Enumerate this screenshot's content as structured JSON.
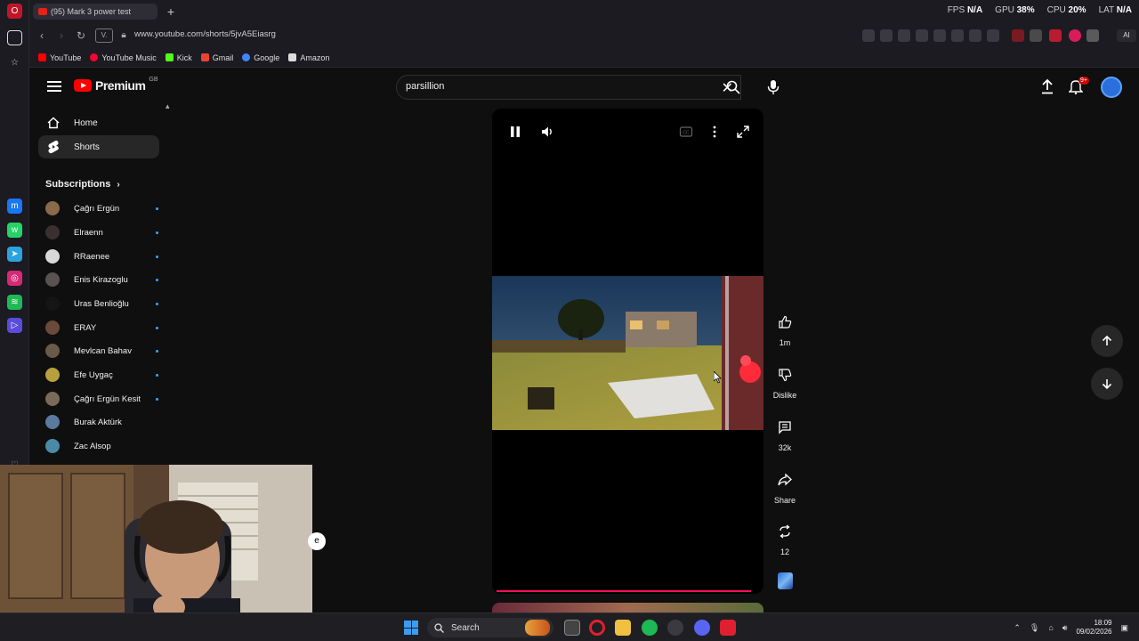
{
  "browser": {
    "tab_title": "(95) Mark 3 power test",
    "stats": [
      {
        "label": "FPS",
        "value": "N/A"
      },
      {
        "label": "GPU",
        "value": "38%"
      },
      {
        "label": "CPU",
        "value": "20%"
      },
      {
        "label": "LAT",
        "value": "N/A"
      }
    ],
    "url": "www.youtube.com/shorts/5jvA5Eiasrg",
    "bookmarks": [
      {
        "label": "YouTube",
        "color": "#ff0000"
      },
      {
        "label": "YouTube Music",
        "color": "#ff0033"
      },
      {
        "label": "Kick",
        "color": "#53fc18"
      },
      {
        "label": "Gmail",
        "color": "#ea4335"
      },
      {
        "label": "Google",
        "color": "#4285f4"
      },
      {
        "label": "Amazon",
        "color": "#dddddd"
      }
    ]
  },
  "header": {
    "logo_text": "Premium",
    "logo_super": "GB",
    "search_value": "parsillion",
    "notification_count": "9+"
  },
  "guide": {
    "items": [
      {
        "label": "Home",
        "icon": "home-icon"
      },
      {
        "label": "Shorts",
        "icon": "shorts-icon"
      }
    ],
    "subscriptions_title": "Subscriptions",
    "subscriptions": [
      {
        "name": "Çağrı Ergün",
        "color": "#8a6a4a",
        "new": true
      },
      {
        "name": "Elraenn",
        "color": "#3a3030",
        "new": true
      },
      {
        "name": "RRaenee",
        "color": "#d8d8d8",
        "new": true
      },
      {
        "name": "Enis Kirazoglu",
        "color": "#5a5250",
        "new": true
      },
      {
        "name": "Uras Benlioğlu",
        "color": "#151515",
        "new": true
      },
      {
        "name": "ERAY",
        "color": "#6a4a3a",
        "new": true
      },
      {
        "name": "Mevlcan Bahav",
        "color": "#6a5a4a",
        "new": true
      },
      {
        "name": "Efe Uygaç",
        "color": "#b8a040",
        "new": true
      },
      {
        "name": "Çağrı Ergün Kesit",
        "color": "#7a6a5a",
        "new": true
      },
      {
        "name": "Burak Aktürk",
        "color": "#5a7aa0",
        "new": false
      },
      {
        "name": "Zac Alsop",
        "color": "#4a8aa8",
        "new": false
      }
    ]
  },
  "player": {
    "progress": 0.97
  },
  "actions": {
    "like_count": "1m",
    "dislike_label": "Dislike",
    "comment_count": "32k",
    "share_label": "Share",
    "remix_count": "12"
  },
  "webcam": {
    "chip_text": "e"
  },
  "taskbar": {
    "search_label": "Search",
    "time": "18:09",
    "date": "09/02/2026"
  }
}
